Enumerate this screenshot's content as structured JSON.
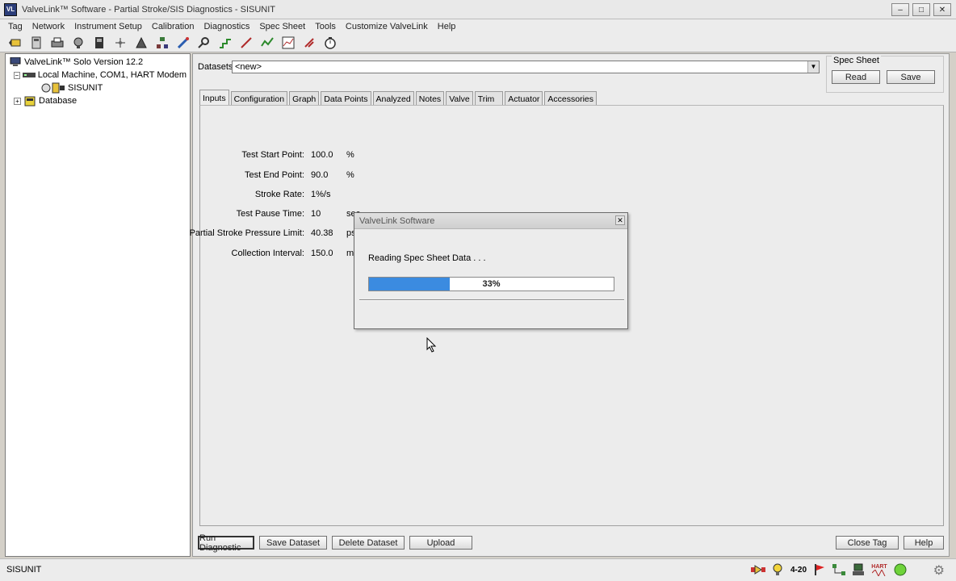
{
  "window": {
    "title": "ValveLink™ Software - Partial Stroke/SIS Diagnostics - SISUNIT",
    "app_icon_text": "VL",
    "minimize": "–",
    "maximize": "□",
    "close": "✕"
  },
  "menu": [
    "Tag",
    "Network",
    "Instrument Setup",
    "Calibration",
    "Diagnostics",
    "Spec Sheet",
    "Tools",
    "Customize ValveLink",
    "Help"
  ],
  "tree": {
    "root": "ValveLink™ Solo Version 12.2",
    "local": "Local Machine, COM1, HART Modem",
    "device": "SISUNIT",
    "database": "Database"
  },
  "datasets": {
    "label": "Datasets:",
    "value": "<new>"
  },
  "spec_sheet": {
    "title": "Spec Sheet",
    "read": "Read",
    "save": "Save"
  },
  "tabs": [
    "Inputs",
    "Configuration",
    "Graph",
    "Data Points",
    "Analyzed",
    "Notes",
    "Valve",
    "Trim",
    "Actuator",
    "Accessories"
  ],
  "fields": [
    {
      "label": "Test Start Point:",
      "value": "100.0",
      "unit": "%"
    },
    {
      "label": "Test End Point:",
      "value": "90.0",
      "unit": "%"
    },
    {
      "label": "Stroke Rate:",
      "value": "1%/s",
      "unit": ""
    },
    {
      "label": "Test Pause Time:",
      "value": "10",
      "unit": "sec"
    },
    {
      "label": "Partial Stroke Pressure Limit:",
      "value": "40.38",
      "unit": "psi"
    },
    {
      "label": "Collection Interval:",
      "value": "150.0",
      "unit": "ms"
    }
  ],
  "buttons": {
    "run": "Run Diagnostic",
    "save_dataset": "Save Dataset",
    "delete_dataset": "Delete Dataset",
    "upload": "Upload",
    "close_tag": "Close Tag",
    "help": "Help"
  },
  "dialog": {
    "title": "ValveLink Software",
    "message": "Reading Spec Sheet Data . . .",
    "progress": 0.33,
    "progress_text": "33%"
  },
  "status": {
    "text": "SISUNIT",
    "icons": [
      "valve-icon",
      "bulb-icon",
      "4-20",
      "flag-icon",
      "network-icon",
      "hart-device-icon",
      "HART",
      "status-circle-icon"
    ]
  },
  "colors": {
    "progress": "#3b8be0",
    "panel": "#ececec"
  }
}
